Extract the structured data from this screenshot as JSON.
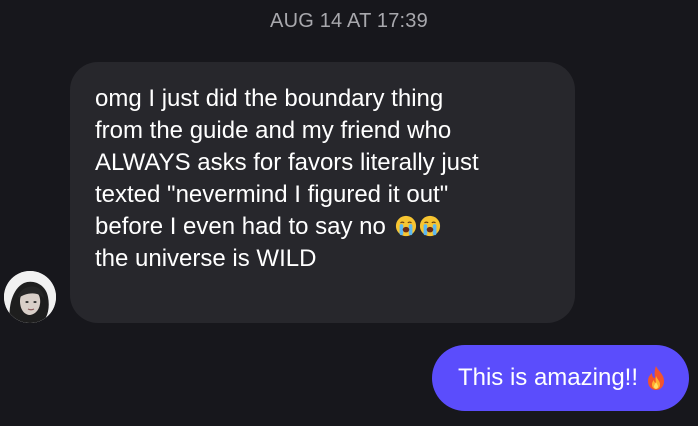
{
  "thread": {
    "timestamp": "AUG 14 AT 17:39"
  },
  "incoming": {
    "lines": [
      "omg I just did the boundary thing",
      "from the guide and my friend who",
      "ALWAYS asks for favors literally just",
      "texted \"nevermind I figured it out\"",
      "before I even had to say no",
      "the universe is WILD"
    ],
    "emojis": [
      "crying-face-emoji",
      "crying-face-emoji"
    ]
  },
  "outgoing": {
    "text": "This is amazing!!",
    "emoji": "fire-emoji",
    "bubble_color": "#5b4dfc"
  },
  "colors": {
    "background": "#17171c",
    "incoming_bubble": "#27272c",
    "timestamp": "#a8a8ad"
  }
}
